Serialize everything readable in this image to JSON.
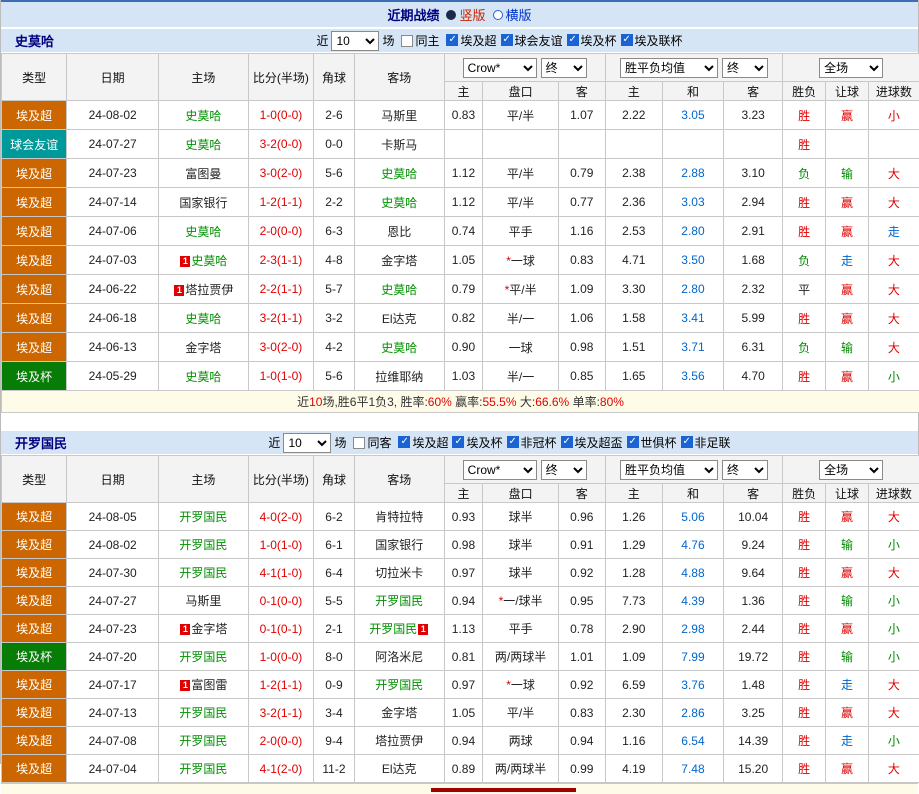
{
  "topbar": {
    "title": "近期战绩",
    "vertical": "竖版",
    "horizontal": "横版"
  },
  "table_headers": {
    "league": "类型",
    "date": "日期",
    "home": "主场",
    "score": "比分(半场)",
    "corner": "角球",
    "away": "客场",
    "company": "Crow*",
    "final1": "终",
    "europe": "胜平负均值",
    "final2": "终",
    "scope": "全场",
    "sub": [
      "主",
      "盘口",
      "客",
      "主",
      "和",
      "客",
      "胜负",
      "让球",
      "进球数"
    ]
  },
  "colors": {
    "accent_blue": "#1a63d4",
    "win_red": "#e00000",
    "lose_green": "#008a00",
    "push_blue": "#0066cc",
    "league_super": "#cc6600",
    "league_friendly": "#009999",
    "league_cup": "#077d07"
  },
  "sections": [
    {
      "team": "史莫哈",
      "filter": {
        "near": "近",
        "count": "10",
        "unit": "场",
        "same": "同主",
        "same_checked": false,
        "leagues": [
          {
            "label": "埃及超",
            "checked": true
          },
          {
            "label": "球会友谊",
            "checked": true
          },
          {
            "label": "埃及杯",
            "checked": true
          },
          {
            "label": "埃及联杯",
            "checked": true
          }
        ]
      },
      "rows": [
        {
          "lg": "埃及超",
          "lgc": "super",
          "date": "24-08-02",
          "home": "史莫哈",
          "ht": true,
          "score": "1-0(0-0)",
          "cor": "2-6",
          "away": "马斯里",
          "at": false,
          "a1": "0.83",
          "hc": "平/半",
          "a2": "1.07",
          "e1": "2.22",
          "e2": "3.05",
          "e3": "3.23",
          "r1": "胜",
          "c1": "r",
          "r2": "赢",
          "c2": "r",
          "r3": "小",
          "c3": "r"
        },
        {
          "lg": "球会友谊",
          "lgc": "friendly",
          "date": "24-07-27",
          "home": "史莫哈",
          "ht": true,
          "score": "3-2(0-0)",
          "cor": "0-0",
          "away": "卡斯马",
          "at": false,
          "a1": "",
          "hc": "",
          "a2": "",
          "e1": "",
          "e2": "",
          "e3": "",
          "r1": "胜",
          "c1": "r",
          "r2": "",
          "c2": "",
          "r3": "",
          "c3": ""
        },
        {
          "lg": "埃及超",
          "lgc": "super",
          "date": "24-07-23",
          "home": "富图曼",
          "ht": false,
          "score": "3-0(2-0)",
          "cor": "5-6",
          "away": "史莫哈",
          "at": true,
          "a1": "1.12",
          "hc": "平/半",
          "a2": "0.79",
          "e1": "2.38",
          "e2": "2.88",
          "e3": "3.10",
          "r1": "负",
          "c1": "g",
          "r2": "输",
          "c2": "g",
          "r3": "大",
          "c3": "r"
        },
        {
          "lg": "埃及超",
          "lgc": "super",
          "date": "24-07-14",
          "home": "国家银行",
          "ht": false,
          "score": "1-2(1-1)",
          "cor": "2-2",
          "away": "史莫哈",
          "at": true,
          "a1": "1.12",
          "hc": "平/半",
          "a2": "0.77",
          "e1": "2.36",
          "e2": "3.03",
          "e3": "2.94",
          "r1": "胜",
          "c1": "r",
          "r2": "赢",
          "c2": "r",
          "r3": "大",
          "c3": "r"
        },
        {
          "lg": "埃及超",
          "lgc": "super",
          "date": "24-07-06",
          "home": "史莫哈",
          "ht": true,
          "score": "2-0(0-0)",
          "cor": "6-3",
          "away": "恩比",
          "at": false,
          "a1": "0.74",
          "hc": "平手",
          "a2": "1.16",
          "e1": "2.53",
          "e2": "2.80",
          "e3": "2.91",
          "r1": "胜",
          "c1": "r",
          "r2": "赢",
          "c2": "r",
          "r3": "走",
          "c3": "b"
        },
        {
          "lg": "埃及超",
          "lgc": "super",
          "date": "24-07-03",
          "hb": "1",
          "home": "史莫哈",
          "ht": true,
          "score": "2-3(1-1)",
          "cor": "4-8",
          "away": "金字塔",
          "at": false,
          "a1": "1.05",
          "star": true,
          "hc": "一球",
          "a2": "0.83",
          "e1": "4.71",
          "e2": "3.50",
          "e3": "1.68",
          "r1": "负",
          "c1": "g",
          "r2": "走",
          "c2": "b",
          "r3": "大",
          "c3": "r"
        },
        {
          "lg": "埃及超",
          "lgc": "super",
          "date": "24-06-22",
          "hb": "1",
          "home": "塔拉贾伊",
          "ht": false,
          "score": "2-2(1-1)",
          "cor": "5-7",
          "away": "史莫哈",
          "at": true,
          "a1": "0.79",
          "star": true,
          "hc": "平/半",
          "a2": "1.09",
          "e1": "3.30",
          "e2": "2.80",
          "e3": "2.32",
          "r1": "平",
          "c1": "k",
          "r2": "赢",
          "c2": "r",
          "r3": "大",
          "c3": "r"
        },
        {
          "lg": "埃及超",
          "lgc": "super",
          "date": "24-06-18",
          "home": "史莫哈",
          "ht": true,
          "score": "3-2(1-1)",
          "cor": "3-2",
          "away": "El达克",
          "at": false,
          "a1": "0.82",
          "hc": "半/一",
          "a2": "1.06",
          "e1": "1.58",
          "e2": "3.41",
          "e3": "5.99",
          "r1": "胜",
          "c1": "r",
          "r2": "赢",
          "c2": "r",
          "r3": "大",
          "c3": "r"
        },
        {
          "lg": "埃及超",
          "lgc": "super",
          "date": "24-06-13",
          "home": "金字塔",
          "ht": false,
          "score": "3-0(2-0)",
          "cor": "4-2",
          "away": "史莫哈",
          "at": true,
          "a1": "0.90",
          "hc": "一球",
          "a2": "0.98",
          "e1": "1.51",
          "e2": "3.71",
          "e3": "6.31",
          "r1": "负",
          "c1": "g",
          "r2": "输",
          "c2": "g",
          "r3": "大",
          "c3": "r"
        },
        {
          "lg": "埃及杯",
          "lgc": "cup",
          "date": "24-05-29",
          "home": "史莫哈",
          "ht": true,
          "score": "1-0(1-0)",
          "cor": "5-6",
          "away": "拉维耶纳",
          "at": false,
          "a1": "1.03",
          "hc": "半/一",
          "a2": "0.85",
          "e1": "1.65",
          "e2": "3.56",
          "e3": "4.70",
          "r1": "胜",
          "c1": "r",
          "r2": "赢",
          "c2": "r",
          "r3": "小",
          "c3": "g"
        }
      ],
      "summary": [
        {
          "t": "近"
        },
        {
          "t": "10",
          "c": "r"
        },
        {
          "t": "场,胜6平1负3, 胜率:"
        },
        {
          "t": "60%",
          "c": "r"
        },
        {
          "t": " 赢率:"
        },
        {
          "t": "55.5%",
          "c": "r"
        },
        {
          "t": " 大:"
        },
        {
          "t": "66.6%",
          "c": "r"
        },
        {
          "t": " 单率:"
        },
        {
          "t": "80%",
          "c": "r"
        }
      ]
    },
    {
      "team": "开罗国民",
      "filter": {
        "near": "近",
        "count": "10",
        "unit": "场",
        "same": "同客",
        "same_checked": false,
        "leagues": [
          {
            "label": "埃及超",
            "checked": true
          },
          {
            "label": "埃及杯",
            "checked": true
          },
          {
            "label": "非冠杯",
            "checked": true
          },
          {
            "label": "埃及超盃",
            "checked": true
          },
          {
            "label": "世俱杯",
            "checked": true
          },
          {
            "label": "非足联",
            "checked": true
          }
        ]
      },
      "rows": [
        {
          "lg": "埃及超",
          "lgc": "super",
          "date": "24-08-05",
          "home": "开罗国民",
          "ht": true,
          "score": "4-0(2-0)",
          "cor": "6-2",
          "away": "肯特拉特",
          "at": false,
          "a1": "0.93",
          "hc": "球半",
          "a2": "0.96",
          "e1": "1.26",
          "e2": "5.06",
          "e3": "10.04",
          "r1": "胜",
          "c1": "r",
          "r2": "赢",
          "c2": "r",
          "r3": "大",
          "c3": "r"
        },
        {
          "lg": "埃及超",
          "lgc": "super",
          "date": "24-08-02",
          "home": "开罗国民",
          "ht": true,
          "score": "1-0(1-0)",
          "cor": "6-1",
          "away": "国家银行",
          "at": false,
          "a1": "0.98",
          "hc": "球半",
          "a2": "0.91",
          "e1": "1.29",
          "e2": "4.76",
          "e3": "9.24",
          "r1": "胜",
          "c1": "r",
          "r2": "输",
          "c2": "g",
          "r3": "小",
          "c3": "g"
        },
        {
          "lg": "埃及超",
          "lgc": "super",
          "date": "24-07-30",
          "home": "开罗国民",
          "ht": true,
          "score": "4-1(1-0)",
          "cor": "6-4",
          "away": "切拉米卡",
          "at": false,
          "a1": "0.97",
          "hc": "球半",
          "a2": "0.92",
          "e1": "1.28",
          "e2": "4.88",
          "e3": "9.64",
          "r1": "胜",
          "c1": "r",
          "r2": "赢",
          "c2": "r",
          "r3": "大",
          "c3": "r"
        },
        {
          "lg": "埃及超",
          "lgc": "super",
          "date": "24-07-27",
          "home": "马斯里",
          "ht": false,
          "score": "0-1(0-0)",
          "cor": "5-5",
          "away": "开罗国民",
          "at": true,
          "a1": "0.94",
          "star": true,
          "hc": "一/球半",
          "a2": "0.95",
          "e1": "7.73",
          "e2": "4.39",
          "e3": "1.36",
          "r1": "胜",
          "c1": "r",
          "r2": "输",
          "c2": "g",
          "r3": "小",
          "c3": "g"
        },
        {
          "lg": "埃及超",
          "lgc": "super",
          "date": "24-07-23",
          "hb": "1",
          "home": "金字塔",
          "ht": false,
          "score": "0-1(0-1)",
          "cor": "2-1",
          "away": "开罗国民",
          "at": true,
          "ab2": "1",
          "a1": "1.13",
          "hc": "平手",
          "a2": "0.78",
          "e1": "2.90",
          "e2": "2.98",
          "e3": "2.44",
          "r1": "胜",
          "c1": "r",
          "r2": "赢",
          "c2": "r",
          "r3": "小",
          "c3": "g"
        },
        {
          "lg": "埃及杯",
          "lgc": "cup",
          "date": "24-07-20",
          "home": "开罗国民",
          "ht": true,
          "score": "1-0(0-0)",
          "cor": "8-0",
          "away": "阿洛米尼",
          "at": false,
          "a1": "0.81",
          "hc": "两/两球半",
          "a2": "1.01",
          "e1": "1.09",
          "e2": "7.99",
          "e3": "19.72",
          "r1": "胜",
          "c1": "r",
          "r2": "输",
          "c2": "g",
          "r3": "小",
          "c3": "g"
        },
        {
          "lg": "埃及超",
          "lgc": "super",
          "date": "24-07-17",
          "hb": "1",
          "home": "富图雷",
          "ht": false,
          "score": "1-2(1-1)",
          "cor": "0-9",
          "away": "开罗国民",
          "at": true,
          "a1": "0.97",
          "star": true,
          "hc": "一球",
          "a2": "0.92",
          "e1": "6.59",
          "e2": "3.76",
          "e3": "1.48",
          "r1": "胜",
          "c1": "r",
          "r2": "走",
          "c2": "b",
          "r3": "大",
          "c3": "r"
        },
        {
          "lg": "埃及超",
          "lgc": "super",
          "date": "24-07-13",
          "home": "开罗国民",
          "ht": true,
          "score": "3-2(1-1)",
          "cor": "3-4",
          "away": "金字塔",
          "at": false,
          "a1": "1.05",
          "hc": "平/半",
          "a2": "0.83",
          "e1": "2.30",
          "e2": "2.86",
          "e3": "3.25",
          "r1": "胜",
          "c1": "r",
          "r2": "赢",
          "c2": "r",
          "r3": "大",
          "c3": "r"
        },
        {
          "lg": "埃及超",
          "lgc": "super",
          "date": "24-07-08",
          "home": "开罗国民",
          "ht": true,
          "score": "2-0(0-0)",
          "cor": "9-4",
          "away": "塔拉贾伊",
          "at": false,
          "a1": "0.94",
          "hc": "两球",
          "a2": "0.94",
          "e1": "1.16",
          "e2": "6.54",
          "e3": "14.39",
          "r1": "胜",
          "c1": "r",
          "r2": "走",
          "c2": "b",
          "r3": "小",
          "c3": "g"
        },
        {
          "lg": "埃及超",
          "lgc": "super",
          "date": "24-07-04",
          "home": "开罗国民",
          "ht": true,
          "score": "4-1(2-0)",
          "cor": "11-2",
          "away": "El达克",
          "at": false,
          "a1": "0.89",
          "hc": "两/两球半",
          "a2": "0.99",
          "e1": "4.19",
          "e2": "7.48",
          "e3": "15.20",
          "r1": "胜",
          "c1": "r",
          "r2": "赢",
          "c2": "r",
          "r3": "大",
          "c3": "r"
        }
      ]
    }
  ]
}
